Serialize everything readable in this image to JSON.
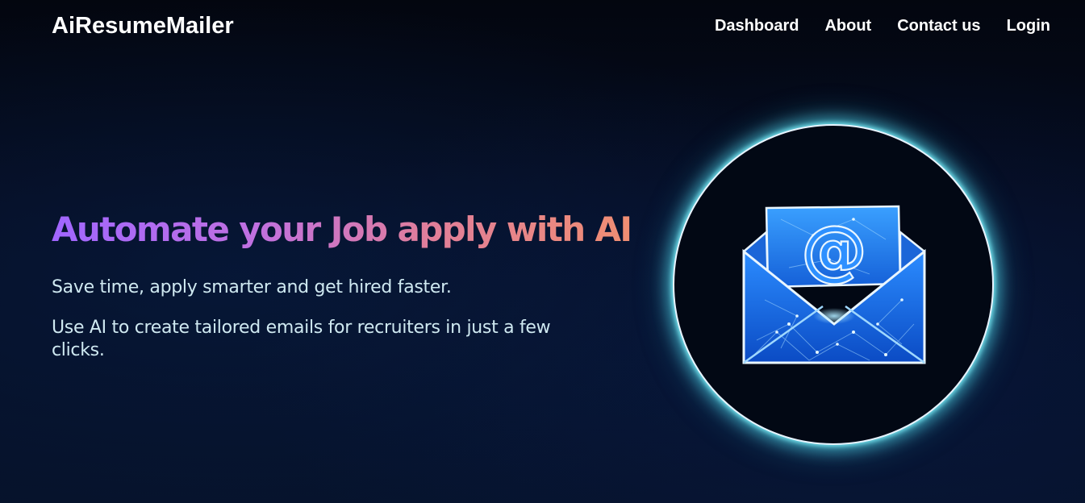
{
  "nav": {
    "brand": "AiResumeMailer",
    "links": [
      "Dashboard",
      "About",
      "Contact us",
      "Login"
    ]
  },
  "hero": {
    "title": "Automate your Job apply with AI",
    "subtitle": "Save time, apply smarter and get hired faster.",
    "description": "Use AI to create tailored emails for recruiters in just a few clicks."
  },
  "image": {
    "icon": "email-envelope-at-icon",
    "glyph": "@"
  },
  "colors": {
    "background": "#050d22",
    "title_gradient_start": "#a066ff",
    "title_gradient_end": "#f08e72",
    "body_text": "#cfe9f1",
    "glow": "#5fd8e8",
    "envelope_blue": "#1f7ef0"
  }
}
